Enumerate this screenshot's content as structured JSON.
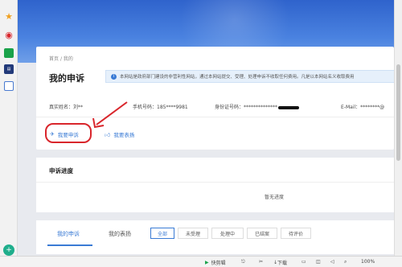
{
  "breadcrumb": {
    "home": "首页",
    "sep": "/",
    "current": "我的"
  },
  "page": {
    "title": "我的申诉"
  },
  "notice": {
    "text": "本网站是政府部门建设的非营利性网站，通过本网站提交、受理、处理申诉不收取任何费用。凡是以本网站名义收取费用"
  },
  "user_info": {
    "name_label": "真实姓名：",
    "name_value": "刘**",
    "phone_label": "手机号码：",
    "phone_value": "185****9981",
    "id_label": "身份证号码：",
    "id_value": "**************",
    "email_label": "E-Mail：",
    "email_value": "********@"
  },
  "actions": {
    "complaint": "我要申诉",
    "praise": "我要表扬"
  },
  "progress": {
    "title": "申诉进度",
    "empty": "暂无进度"
  },
  "tabs": {
    "complaint": "我的申诉",
    "praise": "我的表扬"
  },
  "filters": [
    "全部",
    "未受理",
    "处理中",
    "已结案",
    "待评价"
  ],
  "statusbar": {
    "clip": "快剪辑",
    "download": "下载",
    "zoom": "100%"
  },
  "colors": {
    "accent": "#3a7bd5",
    "annotation": "#d9262c",
    "banner": "#2f63cc"
  },
  "icons": [
    "star-icon",
    "weibo-icon",
    "mail-icon",
    "news-icon",
    "doc-icon",
    "plane-icon",
    "thumbs-up-icon",
    "info-icon"
  ]
}
